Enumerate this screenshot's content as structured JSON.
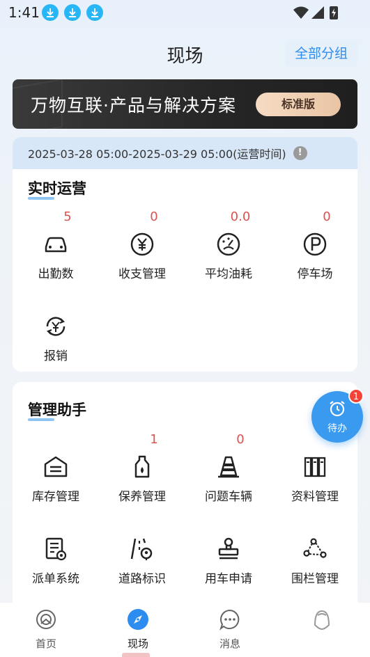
{
  "status_bar": {
    "time": "1:41"
  },
  "header": {
    "title": "现场",
    "group_button": "全部分组"
  },
  "banner": {
    "text": "万物互联·产品与解决方案",
    "button": "标准版"
  },
  "operations": {
    "time_range": "2025-03-28 05:00-2025-03-29 05:00(运营时间)",
    "info_glyph": "!",
    "title": "实时运营",
    "items": [
      {
        "count": "5",
        "label": "出勤数",
        "icon": "car-icon"
      },
      {
        "count": "0",
        "label": "收支管理",
        "icon": "yen-icon"
      },
      {
        "count": "0.0",
        "label": "平均油耗",
        "icon": "gauge-icon"
      },
      {
        "count": "0",
        "label": "停车场",
        "icon": "parking-icon"
      },
      {
        "count": "",
        "label": "报销",
        "icon": "reimburse-icon"
      }
    ]
  },
  "management": {
    "title": "管理助手",
    "items": [
      {
        "count": "",
        "label": "库存管理",
        "icon": "warehouse-icon"
      },
      {
        "count": "1",
        "label": "保养管理",
        "icon": "oil-bottle-icon"
      },
      {
        "count": "0",
        "label": "问题车辆",
        "icon": "traffic-cone-icon"
      },
      {
        "count": "",
        "label": "资料管理",
        "icon": "binders-icon"
      },
      {
        "count": "",
        "label": "派单系统",
        "icon": "dispatch-doc-icon"
      },
      {
        "count": "",
        "label": "道路标识",
        "icon": "road-sign-icon"
      },
      {
        "count": "",
        "label": "用车申请",
        "icon": "stamp-icon"
      },
      {
        "count": "",
        "label": "围栏管理",
        "icon": "geofence-icon"
      }
    ]
  },
  "todo": {
    "label": "待办",
    "badge": "1"
  },
  "bottom_nav": [
    {
      "label": "首页",
      "icon": "home-icon",
      "active": false
    },
    {
      "label": "现场",
      "icon": "compass-icon",
      "active": true
    },
    {
      "label": "消息",
      "icon": "chat-icon",
      "active": false
    },
    {
      "label": "",
      "icon": "profile-icon",
      "active": false
    }
  ],
  "colors": {
    "accent": "#2d8cf0",
    "count_red": "#d9534f",
    "fab_blue": "#3a9af0",
    "badge_red": "#f44336"
  }
}
